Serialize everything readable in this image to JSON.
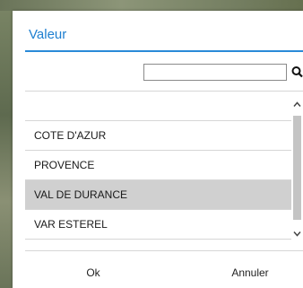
{
  "dialog": {
    "title": "Valeur",
    "accent_color": "#1e7fd0"
  },
  "search": {
    "value": "",
    "placeholder": "",
    "icon": "search-icon"
  },
  "list": {
    "items": [
      {
        "label": ""
      },
      {
        "label": "COTE D'AZUR"
      },
      {
        "label": "PROVENCE"
      },
      {
        "label": "VAL DE DURANCE",
        "selected": true
      },
      {
        "label": "VAR ESTEREL"
      }
    ],
    "selected_color": "#d0d0d0"
  },
  "scrollbar": {
    "up_icon": "chevron-up-icon",
    "down_icon": "chevron-down-icon"
  },
  "footer": {
    "ok_label": "Ok",
    "cancel_label": "Annuler"
  }
}
